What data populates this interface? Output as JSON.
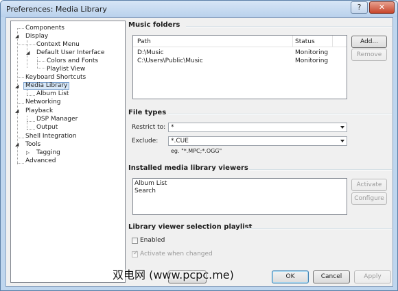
{
  "window": {
    "title": "Preferences: Media Library",
    "help_glyph": "?",
    "close_glyph": "✕"
  },
  "tree": {
    "items": [
      {
        "label": "Components"
      },
      {
        "label": "Display",
        "toggle": "◢"
      },
      {
        "label": "Context Menu"
      },
      {
        "label": "Default User Interface",
        "toggle": "◢"
      },
      {
        "label": "Colors and Fonts"
      },
      {
        "label": "Playlist View"
      },
      {
        "label": "Keyboard Shortcuts"
      },
      {
        "label": "Media Library",
        "toggle": "◢",
        "selected": true
      },
      {
        "label": "Album List"
      },
      {
        "label": "Networking"
      },
      {
        "label": "Playback",
        "toggle": "◢"
      },
      {
        "label": "DSP Manager"
      },
      {
        "label": "Output"
      },
      {
        "label": "Shell Integration"
      },
      {
        "label": "Tools",
        "toggle": "◢"
      },
      {
        "label": "Tagging",
        "toggle": "▷"
      },
      {
        "label": "Advanced"
      }
    ]
  },
  "music_folders": {
    "title": "Music folders",
    "columns": [
      "Path",
      "Status"
    ],
    "rows": [
      {
        "path": "D:\\Music",
        "status": "Monitoring"
      },
      {
        "path": "C:\\Users\\Public\\Music",
        "status": "Monitoring"
      }
    ],
    "add_label": "Add...",
    "remove_label": "Remove"
  },
  "file_types": {
    "title": "File types",
    "restrict_label": "Restrict to:",
    "restrict_value": "*",
    "exclude_label": "Exclude:",
    "exclude_value": "*.CUE",
    "hint": "eg. \"*.MPC;*.OGG\""
  },
  "viewers": {
    "title": "Installed media library viewers",
    "items": [
      "Album List",
      "Search"
    ],
    "activate_label": "Activate",
    "configure_label": "Configure"
  },
  "playlist": {
    "title": "Library viewer selection playlist",
    "enabled_label": "Enabled",
    "enabled_checked": false,
    "activate_label": "Activate when changed",
    "activate_checked": true
  },
  "footer": {
    "ok_label": "OK",
    "cancel_label": "Cancel",
    "apply_label": "Apply",
    "watermark": "双电网 (www.pcpc.me)"
  }
}
